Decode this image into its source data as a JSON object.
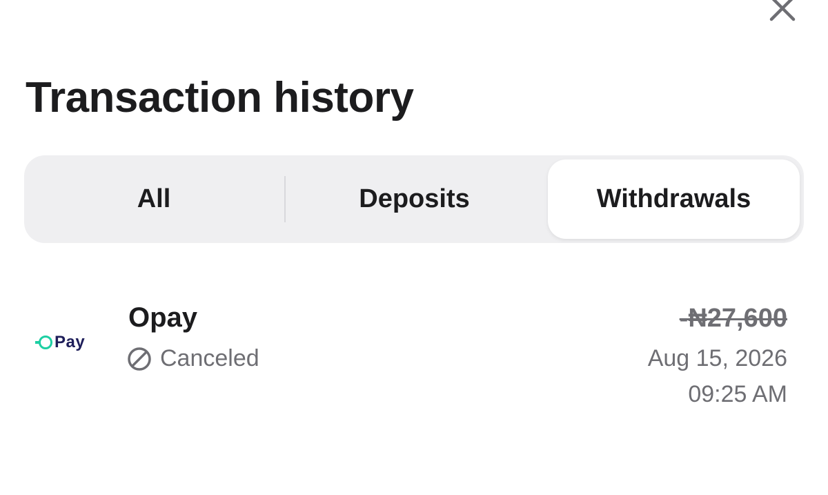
{
  "header": {
    "close_icon": "close-icon",
    "title": "Transaction history"
  },
  "tabs": {
    "items": [
      {
        "label": "All",
        "selected": false
      },
      {
        "label": "Deposits",
        "selected": false
      },
      {
        "label": "Withdrawals",
        "selected": true
      }
    ]
  },
  "transactions": [
    {
      "logo_text": "Pay",
      "logo_icon": "opay-logo",
      "name": "Opay",
      "status": "Canceled",
      "status_icon": "cancel-icon",
      "amount": "-₦27,600",
      "date": "Aug 15, 2026",
      "time": "09:25 AM"
    }
  ],
  "colors": {
    "text_primary": "#1c1c1e",
    "text_secondary": "#6e6e73",
    "segment_bg": "#efeff1",
    "opay_green": "#1dcfa3",
    "opay_navy": "#1e1e5a"
  }
}
